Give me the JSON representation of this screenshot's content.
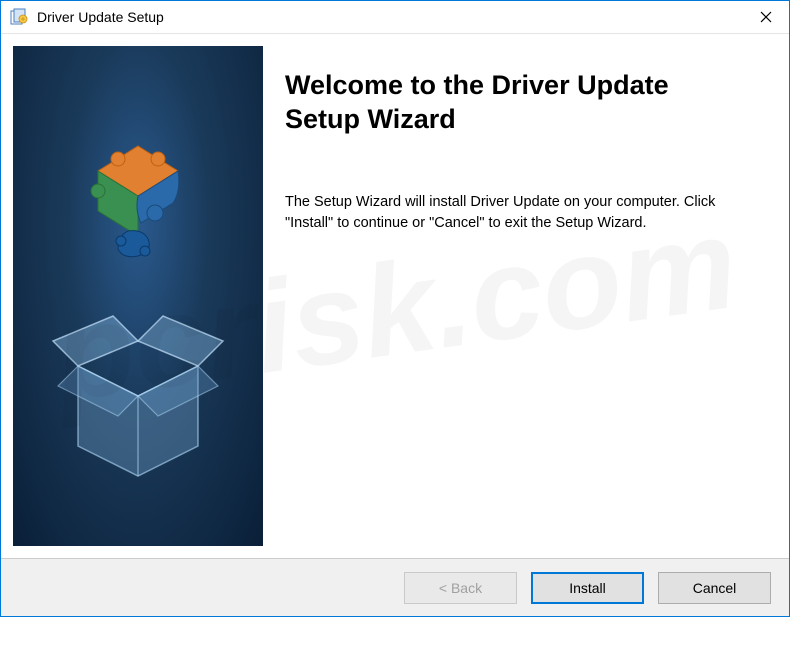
{
  "window": {
    "title": "Driver Update Setup"
  },
  "content": {
    "heading": "Welcome to the Driver Update Setup Wizard",
    "body": "The Setup Wizard will install Driver Update on your computer.  Click \"Install\" to continue or \"Cancel\" to exit the Setup Wizard."
  },
  "buttons": {
    "back": "< Back",
    "install": "Install",
    "cancel": "Cancel"
  },
  "watermark": "pcrisk.com"
}
